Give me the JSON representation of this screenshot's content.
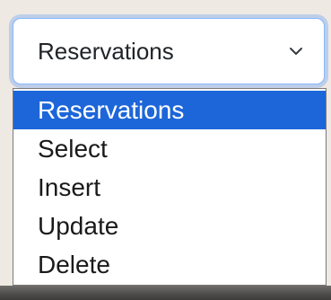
{
  "select": {
    "value": "Reservations",
    "options": [
      {
        "label": "Reservations",
        "selected": true
      },
      {
        "label": "Select",
        "selected": false
      },
      {
        "label": "Insert",
        "selected": false
      },
      {
        "label": "Update",
        "selected": false
      },
      {
        "label": "Delete",
        "selected": false
      }
    ],
    "focus_color": "#86b7fe",
    "highlight_color": "#1d66d9"
  }
}
